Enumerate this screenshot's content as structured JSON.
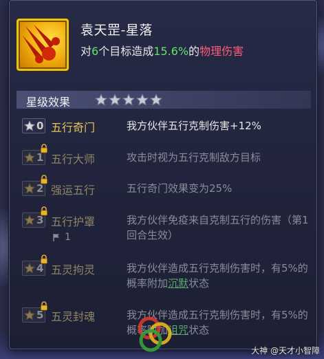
{
  "skill": {
    "name": "袁天罡-星落",
    "desc_prefix": "对",
    "targets": "6",
    "desc_mid": "个目标造成",
    "percent": "15.6%",
    "desc_of": "的",
    "damage_type": "物理伤害",
    "icon": "meteor-icon"
  },
  "star_section": {
    "title": "星级效果",
    "star_count": 5,
    "stars_filled": 0
  },
  "effects": [
    {
      "level": "0",
      "name": "五行奇门",
      "desc": "我方伙伴五行克制伤害+12%",
      "locked": false
    },
    {
      "level": "1",
      "name": "五行大师",
      "desc": "攻击时视为五行克制敌方目标",
      "locked": true
    },
    {
      "level": "2",
      "name": "强运五行",
      "desc": "五行奇门效果变为25%",
      "locked": true
    },
    {
      "level": "3",
      "name": "五行护罩",
      "desc": "我方伙伴免疫来自克制五行的伤害（第1回合生效）",
      "locked": true,
      "flag_count": "1"
    },
    {
      "level": "4",
      "name": "五灵拘灵",
      "desc_before": "我方伙伴造成五行克制伤害时，有5%的概率附加",
      "desc_link": "沉默",
      "desc_after": "状态",
      "locked": true
    },
    {
      "level": "5",
      "name": "五灵封魂",
      "desc_before": "我方伙伴造成五行克制伤害时，有5%的概率附加",
      "desc_link": "诅咒",
      "desc_after": "状态",
      "locked": true
    }
  ],
  "watermark": {
    "text": "大神 @天才小智障"
  },
  "colors": {
    "number_green": "#5fe36a",
    "damage_red": "#ff5a7a",
    "effect_name_gold": "#e4c35a",
    "link_green": "#5aa86a"
  }
}
